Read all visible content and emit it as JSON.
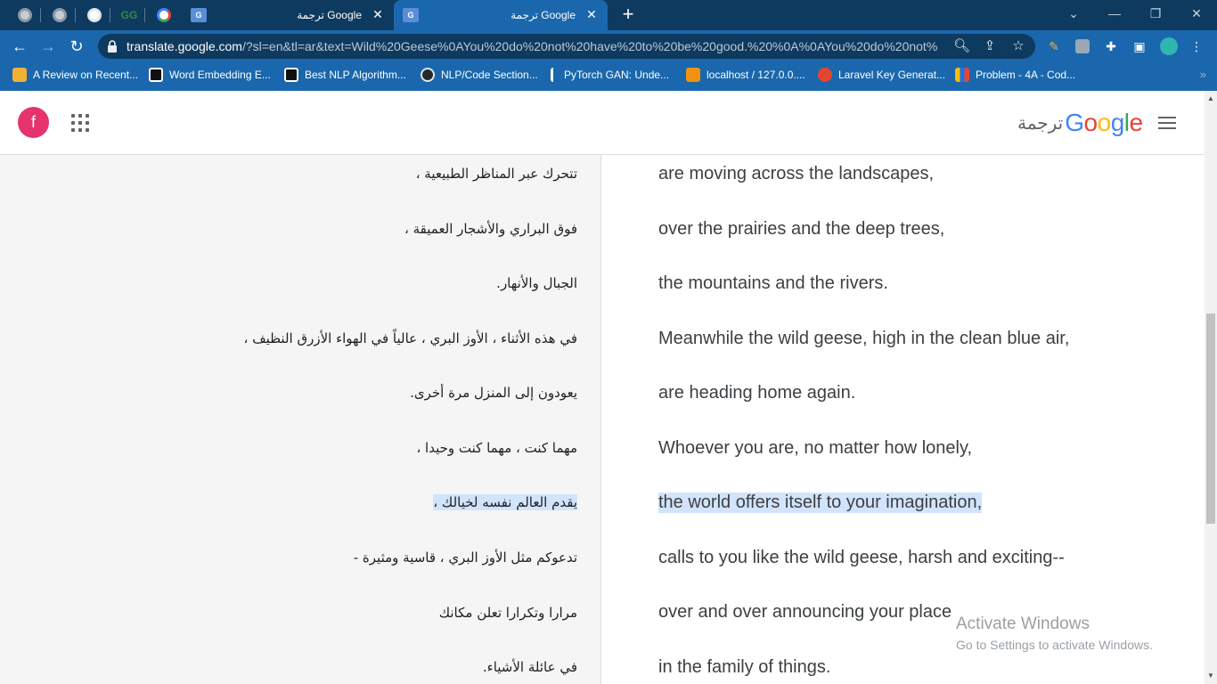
{
  "browser": {
    "pinned_tabs": [
      "globe-icon",
      "globe-icon",
      "globe-icon",
      "geeksforgeeks-icon",
      "google-icon",
      "translate-icon"
    ],
    "tabs": [
      {
        "title": "ترجمة Google",
        "active": false
      },
      {
        "title": "ترجمة Google",
        "active": true
      }
    ],
    "url_host": "translate.google.com",
    "url_rest": "/?sl=en&tl=ar&text=Wild%20Geese%0AYou%20do%20not%20have%20to%20be%20good.%20%0A%0AYou%20do%20not%2...",
    "bookmarks": [
      {
        "label": "A Review on Recent...",
        "icon_color": "#f2b134"
      },
      {
        "label": "Word Embedding E...",
        "icon_color": "#111111"
      },
      {
        "label": "Best NLP Algorithm...",
        "icon_color": "#111111"
      },
      {
        "label": "NLP/Code Section...",
        "icon_color": "#24292e"
      },
      {
        "label": "PyTorch GAN: Unde...",
        "icon_color": "#e0457b"
      },
      {
        "label": "localhost / 127.0.0....",
        "icon_color": "#f29111"
      },
      {
        "label": "Laravel Key Generat...",
        "icon_color": "#e74430"
      },
      {
        "label": "Problem - 4A - Cod...",
        "icon_color": "#fbbc05"
      }
    ]
  },
  "app": {
    "avatar_letter": "f",
    "brand_translate": "ترجمة",
    "brand_google": [
      "G",
      "o",
      "o",
      "g",
      "l",
      "e"
    ],
    "brand_colors": [
      "#4285f4",
      "#ea4335",
      "#fbbc05",
      "#4285f4",
      "#34a853",
      "#ea4335"
    ]
  },
  "translation": {
    "arabic": [
      "تتحرك عبر المناظر الطبيعية ،",
      "فوق البراري والأشجار العميقة ،",
      "الجبال والأنهار.",
      "في هذه الأثناء ، الأوز البري ، عالياً في الهواء الأزرق النظيف ،",
      "يعودون إلى المنزل مرة أخرى.",
      "مهما كنت ، مهما كنت وحيدا ،",
      "يقدم العالم نفسه لخيالك ،",
      "تدعوكم مثل الأوز البري ، قاسية ومثيرة -",
      "مرارا وتكرارا تعلن مكانك",
      "في عائلة الأشياء."
    ],
    "english": [
      "are moving across the landscapes,",
      "over the prairies and the deep trees,",
      "the mountains and the rivers.",
      "Meanwhile the wild geese, high in the clean blue air,",
      "are heading home again.",
      "Whoever you are, no matter how lonely,",
      "the world offers itself to your imagination,",
      "calls to you like the wild geese, harsh and exciting--",
      "over and over announcing your place",
      "in the family of things."
    ],
    "highlighted_index": 6
  },
  "watermark": {
    "line1": "Activate Windows",
    "line2": "Go to Settings to activate Windows."
  }
}
